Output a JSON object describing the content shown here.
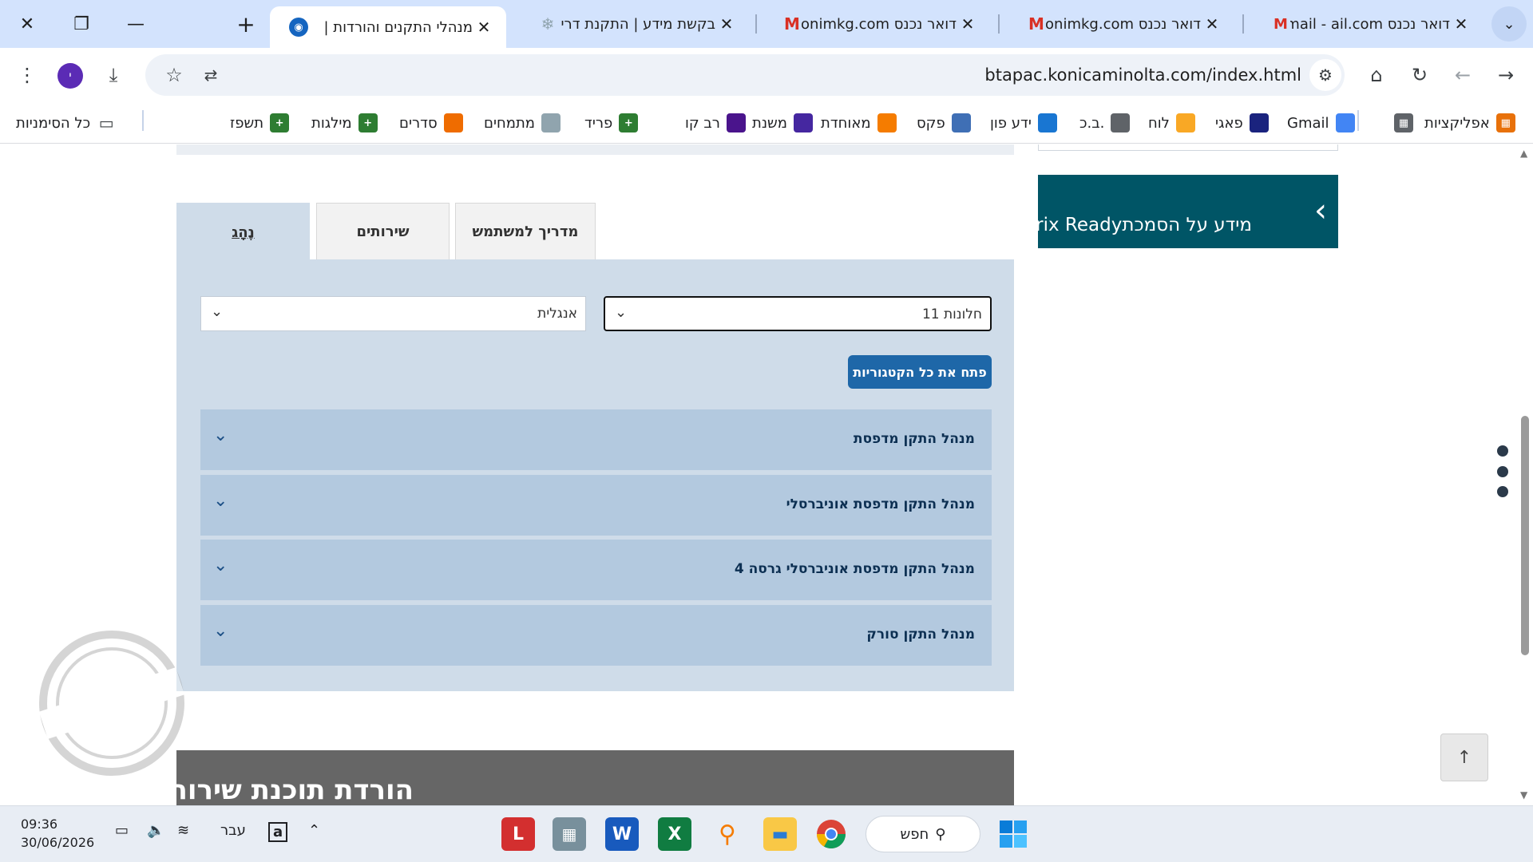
{
  "browser": {
    "tabs": [
      {
        "title": "מנהלי התקנים והורדות | ",
        "favicon": "konica-globe-icon",
        "active": true
      },
      {
        "title": "בקשת מידע | התקנת דרי",
        "favicon": "snowflake-icon",
        "active": false
      },
      {
        "title": "דואר נכנס slonimkg.com",
        "favicon": "gmail-icon",
        "active": false
      },
      {
        "title": "דואר נכנס slonimkg.com",
        "favicon": "gmail-icon",
        "active": false
      },
      {
        "title": "דואר נכנס Gmail - ail.com",
        "favicon": "gmail-100-icon",
        "active": false
      }
    ],
    "tab_close_glyph": "✕",
    "new_tab_glyph": "+",
    "url": "btapac.konicaminolta.com/index.html",
    "avatar_letter": "י",
    "bookmarks": [
      {
        "label": "אפליקציות",
        "icon": "apps-grid-icon",
        "color": "#e8710a"
      },
      {
        "label": "",
        "icon": "grid-icon",
        "color": "#5f6368"
      },
      {
        "label": "Gmail",
        "icon": "google-icon",
        "color": "#4285f4"
      },
      {
        "label": "פאגי",
        "icon": "pagi-icon",
        "color": "#1a237e"
      },
      {
        "label": "לוח",
        "icon": "luach-icon",
        "color": "#f9a825"
      },
      {
        "label": "ב.כ.",
        "icon": "document-icon",
        "color": "#5f6368"
      },
      {
        "label": "ידע פון",
        "icon": "yeda-phone-icon",
        "color": "#1976d2"
      },
      {
        "label": "פקס",
        "icon": "fax-icon",
        "color": "#3f6fb5"
      },
      {
        "label": "מאוחדת",
        "icon": "meuhedet-icon",
        "color": "#f57c00"
      },
      {
        "label": "משנת",
        "icon": "mishnat-icon",
        "color": "#4527a0"
      },
      {
        "label": "רב קו",
        "icon": "ravkav-icon",
        "color": "#4a148c"
      },
      {
        "label": "פריד",
        "icon": "plus-green-icon",
        "color": "#2e7d32"
      },
      {
        "label": "מתמחים",
        "icon": "snowflake-icon",
        "color": "#90a4ae"
      },
      {
        "label": "סדרים",
        "icon": "sdarim-icon",
        "color": "#ef6c00"
      },
      {
        "label": "מילגות",
        "icon": "plus-green-icon",
        "color": "#2e7d32"
      },
      {
        "label": "תשפז",
        "icon": "plus-green-icon",
        "color": "#2e7d32"
      }
    ],
    "all_bookmarks_label": "כל הסימניות"
  },
  "page": {
    "citrix_banner": "מידע על הסמכתCitrix Ready",
    "tabs": [
      {
        "label": "נֶהָג",
        "active": true
      },
      {
        "label": "שירותים",
        "active": false
      },
      {
        "label": "מדריך למשתמש",
        "active": false
      }
    ],
    "os_select": {
      "value": "חלונות 11"
    },
    "lang_select": {
      "value": "אנגלית"
    },
    "expand_all": "פתח את כל הקטגוריות",
    "accordions": [
      {
        "label": "מנהל התקן מדפסת"
      },
      {
        "label": "מנהל התקן מדפסת אוניברסלי"
      },
      {
        "label": "מנהל התקן מדפסת אוניברסלי גרסה 4"
      },
      {
        "label": "מנהל התקן סורק"
      }
    ],
    "download_section_title": "הורדת תוכנת שירות"
  },
  "taskbar": {
    "search_label": "חפש",
    "time": "09:36",
    "date": "30/06/2026",
    "lang": "עבר"
  },
  "colors": {
    "accent_button": "#1e67a8",
    "citrix_banner": "#005566",
    "panel": "#cfdce9",
    "accordion": "#b3c9df",
    "accordion_text": "#0c2f52",
    "tabstrip": "#d3e3fd"
  }
}
